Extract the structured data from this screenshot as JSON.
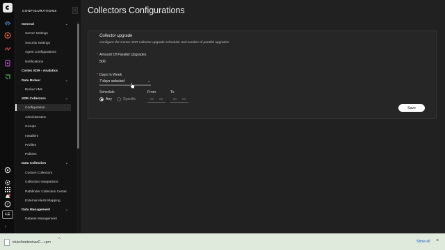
{
  "rail": {
    "icons": [
      "fingerprint-icon",
      "shield-icon",
      "investigation-icon",
      "incident-icon",
      "assets-icon",
      "help-circle-icon",
      "gear-icon",
      "grid-icon",
      "bell-icon",
      "question-icon"
    ],
    "avatar": "LE"
  },
  "nav": {
    "title": "CONFIGURATIONS",
    "collapse_glyph": "‹",
    "general": "General",
    "server_settings": "Server Settings",
    "security_settings": "Security Settings",
    "agent_configurations": "Agent Configurations",
    "notifications": "Notifications",
    "cortex_analytics": "Cortex XDR - Analytics",
    "data_broker": "Data Broker",
    "broker_vms": "Broker VMs",
    "xdr_collectors": "XDR Collectors",
    "configuration": "Configuration",
    "administration": "Administration",
    "groups": "Groups",
    "installers": "Installers",
    "profiles": "Profiles",
    "policies": "Policies",
    "data_collection": "Data Collection",
    "custom_collectors": "Custom Collectors",
    "collection_integrations": "Collection Integrations",
    "pathfinder_center": "Pathfinder Collection Center",
    "external_alerts_mapping": "External Alerts Mapping",
    "data_management": "Data Management",
    "dataset_management": "Dataset Management",
    "chevron": "⌄"
  },
  "main": {
    "title": "Collectors Configurations",
    "card": {
      "title": "Collector upgrade",
      "subtitle": "Configure the Cortex XDR collector upgrade scheduler and number of parallel upgrades",
      "parallel_label": "Amount Of Parallel Upgrades",
      "parallel_value": "500",
      "days_label": "Days In Week",
      "days_value": "7 days selected",
      "schedule_label": "Schedule",
      "any_label": "Any",
      "specific_label": "Specific",
      "from_label": "From",
      "to_label": "To",
      "from_h": "00",
      "from_m": "00",
      "to_h": "00",
      "to_m": "00",
      "save_label": "Save",
      "required_mark": "*"
    }
  },
  "download_bar": {
    "filename": "eluio4webminarC....rpm",
    "show_all": "Show all",
    "close_glyph": "×",
    "chevron": "^"
  }
}
